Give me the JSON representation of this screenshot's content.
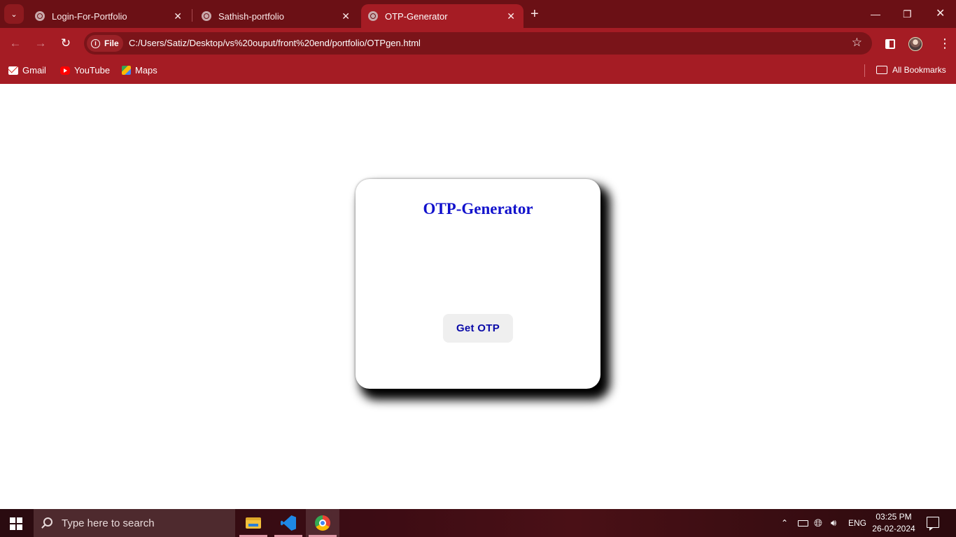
{
  "browser": {
    "tabs": [
      {
        "title": "Login-For-Portfolio",
        "active": false
      },
      {
        "title": "Sathish-portfolio",
        "active": false
      },
      {
        "title": "OTP-Generator",
        "active": true
      }
    ],
    "site_chip_label": "File",
    "url": "C:/Users/Satiz/Desktop/vs%20ouput/front%20end/portfolio/OTPgen.html",
    "bookmarks": [
      {
        "label": "Gmail",
        "icon": "gmail-icon"
      },
      {
        "label": "YouTube",
        "icon": "youtube-icon"
      },
      {
        "label": "Maps",
        "icon": "maps-icon"
      }
    ],
    "all_bookmarks_label": "All Bookmarks",
    "theme_color": "#a51c24"
  },
  "page": {
    "title": "OTP-Generator",
    "get_otp_label": "Get OTP",
    "title_color": "#1111cc",
    "button_text_color": "#0a0aa8"
  },
  "taskbar": {
    "search_placeholder": "Type here to search",
    "apps": [
      "file-explorer",
      "visual-studio-code",
      "google-chrome"
    ],
    "language": "ENG",
    "time": "03:25 PM",
    "date": "26-02-2024"
  }
}
